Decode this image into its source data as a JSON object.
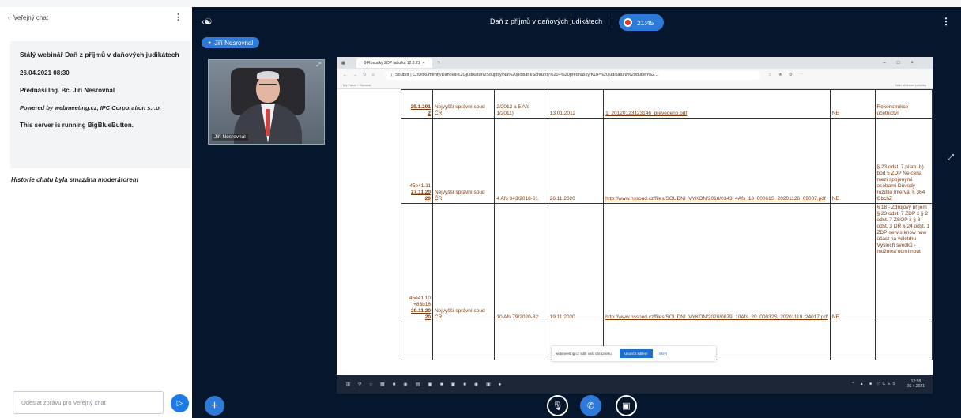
{
  "chat": {
    "back_icon": "chevron-left-icon",
    "title": "Veřejný chat",
    "welcome": {
      "title": "Stálý webinář Daň z příjmů v daňových judikátech",
      "date": "26.04.2021 08:30",
      "presenter": "Přednáší Ing. Bc. Jiří Nesrovnal",
      "powered": "Powered by webmeeting.cz, IPC Corporation s.r.o.",
      "server": "This server is running BigBlueButton."
    },
    "cleared_notice": "Historie chatu byla smazána moderátorem",
    "input_placeholder": "Odeslat zprávu pro Veřejný chat"
  },
  "header": {
    "meeting_title": "Daň z příjmů v daňových judikátech",
    "recording_time": "21:45"
  },
  "talking": {
    "name": "Jiří Nesrovnal"
  },
  "webcam": {
    "name": "Jiří Nesrovnal"
  },
  "browser": {
    "tab_title": "9-Rosudky ZDP tabulka 12.2.21",
    "address": "C:/Dokumenty/Daňová%2Gjudikatura/Soupisy/Na%20poslání/Schůzkly%20+%20přednášky/KDP%20judikatura%20duben%2...",
    "scheme_label": "Soubor",
    "bookmark_left": "My Favor + Bora se",
    "bookmark_right": "Další oblíbené položky"
  },
  "table_rows": [
    {
      "ref": [
        "",
        "29.1.201",
        "2"
      ],
      "court": "Nejvyšší správní soud ČR",
      "case": "2/2012 a 5 Afs 1/2011)",
      "date": "13.01.2012",
      "link": "1_20120123123146_prevedeno.pdf",
      "flag": "NE",
      "note": "Rekonstrukce účetnictví"
    },
    {
      "ref": [
        "45e41.11",
        "27.11.20",
        "20"
      ],
      "court": "Nejvyšší správní soud ČR",
      "case": "4 Afs 343/2018-61",
      "date": "26.11.2020",
      "link": "http://www.nssoud.cz/files/SOUDNI_VYKON/2018/0343_4Afs_18_00061S_20201126_09007.pdf",
      "flag": "NE",
      "note": "§ 23 odst. 7 písm. b) bod 5 ZDP Ne cena mezi spojenými osobami Důvody rozdílu Interval § 364 ObchZ"
    },
    {
      "ref": [
        "45e41.10 +83b16",
        "20.11.20",
        "20"
      ],
      "court": "Nejvyšší správní soud ČR",
      "case": "10 Afs 79/2020-32",
      "date": "19.11.2020",
      "link": "http://www.nssoud.cz/files/SOUDNI_VYKON/2020/0079_10Afs_20_00032S_20201119_24017.pdf",
      "flag": "NE",
      "note": "§ 18 - Zdrojový příjem § 23 odst. 7 ZDP x § 2 odst. 7 ZSOP x § 8 odst. 3 DŘ § 24 odst. 1 ZDP-servis know how účast na veletrhu Výslech svědků -možnost odmítnout"
    }
  ],
  "notice": {
    "text": "webmeeting.cz sdílí vaši obrazovku.",
    "stop": "Ukončit sdílení",
    "hide": "Skrýt"
  },
  "taskbar": {
    "time": "12:58",
    "date": "26.4.2021",
    "lang": "CES"
  },
  "icons": {
    "users": "users-icon",
    "mic": "mic-muted-icon",
    "phone": "phone-icon",
    "camera": "camera-off-icon",
    "plus": "plus-icon",
    "fullscreen": "fullscreen-icon"
  },
  "colors": {
    "main_bg": "#06172d",
    "accent": "#2e7ad8",
    "record_dot": "#e2322f"
  }
}
